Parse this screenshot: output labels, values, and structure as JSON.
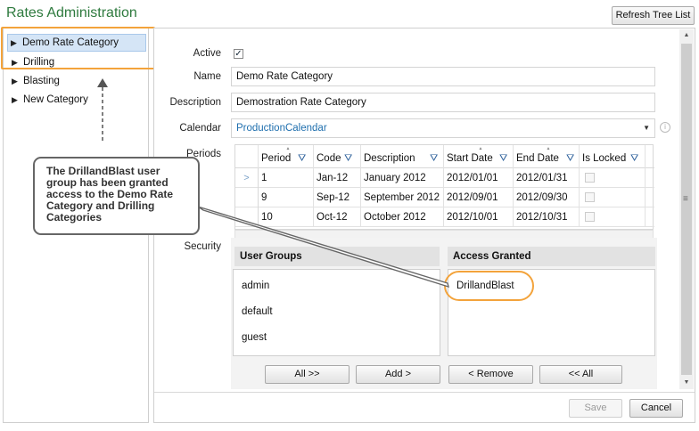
{
  "window": {
    "title": "Rates Administration",
    "refresh_label": "Refresh Tree List"
  },
  "tree": {
    "items": [
      {
        "label": "Demo Rate Category",
        "selected": true
      },
      {
        "label": "Drilling",
        "selected": false
      },
      {
        "label": "Blasting",
        "selected": false
      },
      {
        "label": "New Category",
        "selected": false
      }
    ]
  },
  "form": {
    "active_label": "Active",
    "active_checked": true,
    "name_label": "Name",
    "name_value": "Demo Rate Category",
    "description_label": "Description",
    "description_value": "Demostration Rate Category",
    "calendar_label": "Calendar",
    "calendar_value": "ProductionCalendar",
    "periods_label": "Periods",
    "security_label": "Security"
  },
  "periods_grid": {
    "columns": [
      "Period",
      "Code",
      "Description",
      "Start Date",
      "End Date",
      "Is Locked"
    ],
    "rows": [
      {
        "period": "1",
        "code": "Jan-12",
        "description": "January 2012",
        "start": "2012/01/01",
        "end": "2012/01/31",
        "current": true
      },
      {
        "period": "9",
        "code": "Sep-12",
        "description": "September  2012",
        "start": "2012/09/01",
        "end": "2012/09/30",
        "current": false
      },
      {
        "period": "10",
        "code": "Oct-12",
        "description": "October 2012",
        "start": "2012/10/01",
        "end": "2012/10/31",
        "current": false
      }
    ]
  },
  "security": {
    "user_groups_header": "User Groups",
    "access_granted_header": "Access Granted",
    "user_groups": [
      "admin",
      "default",
      "guest"
    ],
    "access_granted": [
      "DrillandBlast"
    ],
    "buttons": {
      "all_right": "All >>",
      "add": "Add >",
      "remove": "< Remove",
      "all_left": "<< All"
    }
  },
  "footer": {
    "save": "Save",
    "cancel": "Cancel"
  },
  "callout": {
    "text": "The DrillandBlast user group has been granted access to the Demo Rate Category and Drilling Categories"
  },
  "colors": {
    "title_green": "#2e7a3e",
    "highlight_orange": "#f3a33b",
    "selection_blue": "#d5e5f6",
    "link_blue": "#1f6fae"
  },
  "icons": {
    "tree_expander": "triangle-right-icon",
    "filter": "filter-funnel-icon",
    "info": "info-icon",
    "dropdown": "chevron-down-icon"
  }
}
